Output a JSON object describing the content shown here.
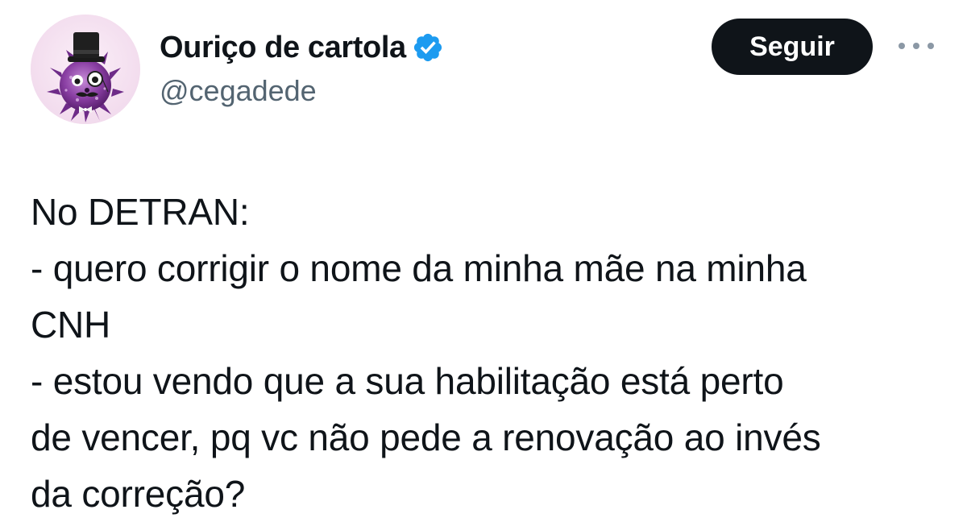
{
  "author": {
    "display_name": "Ouriço de cartola",
    "handle": "@cegadede",
    "verified": true,
    "avatar_icon": "hedgehog-top-hat-avatar"
  },
  "actions": {
    "follow_label": "Seguir",
    "more_icon": "more-horizontal-icon"
  },
  "tweet": {
    "lines": [
      "No DETRAN:",
      "- quero corrigir o nome da minha mãe na minha",
      "CNH",
      "- estou vendo que a sua habilitação está perto",
      "de vencer, pq vc não pede a renovação ao invés",
      "da correção?"
    ]
  },
  "colors": {
    "text_primary": "#0f1419",
    "text_secondary": "#536471",
    "verified_blue": "#1d9bf0",
    "button_bg": "#0f1419",
    "button_text": "#ffffff"
  }
}
